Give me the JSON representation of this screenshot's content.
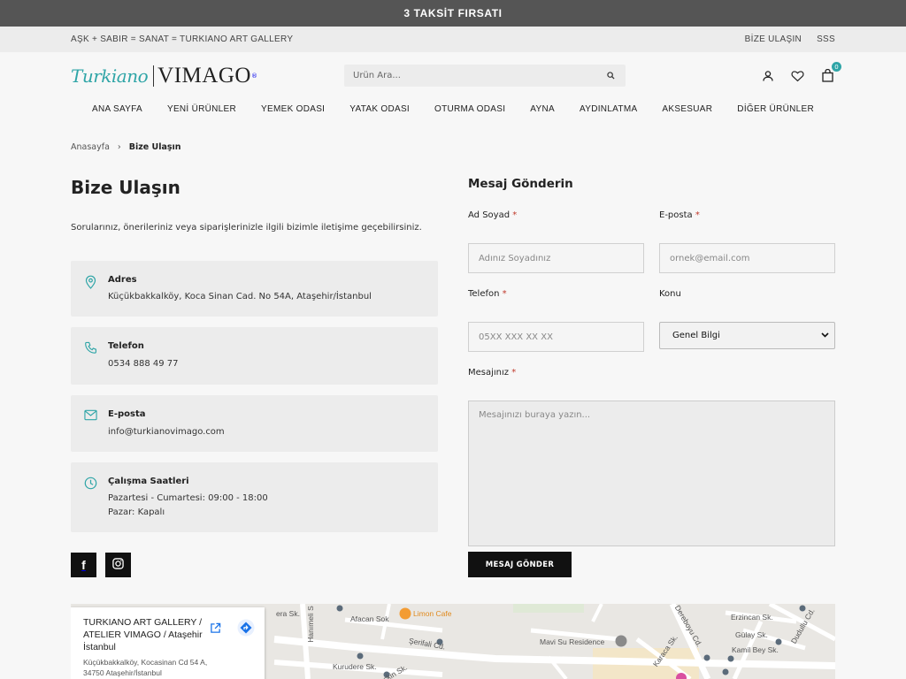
{
  "announcement": "3 TAKSİT FIRSATI",
  "topbar": {
    "tagline": "AŞK + SABIR = SANAT = TURKIANO ART GALLERY",
    "links": [
      "BİZE ULAŞIN",
      "SSS"
    ]
  },
  "logo": {
    "script": "Turkiano",
    "brand": "VIMAGO",
    "mark": "®"
  },
  "search": {
    "placeholder": "Ürün Ara...",
    "icon": "search-icon"
  },
  "header_icons": {
    "account": "user-icon",
    "wishlist": "heart-icon",
    "cart": "cart-icon",
    "cart_count": "0"
  },
  "nav": [
    "ANA SAYFA",
    "YENİ ÜRÜNLER",
    "YEMEK ODASI",
    "YATAK ODASI",
    "OTURMA ODASI",
    "AYNA",
    "AYDINLATMA",
    "AKSESUAR",
    "DİĞER ÜRÜNLER"
  ],
  "breadcrumb": {
    "home": "Anasayfa",
    "separator": "›",
    "current": "Bize Ulaşın"
  },
  "page": {
    "title": "Bize Ulaşın",
    "intro": "Sorularınız, önerileriniz veya siparişlerinizle ilgili bizimle iletişime geçebilirsiniz."
  },
  "contact_cards": [
    {
      "icon": "map-pin-icon",
      "title": "Adres",
      "lines": [
        "Küçükbakkalköy, Koca Sinan Cad. No 54A, Ataşehir/İstanbul"
      ]
    },
    {
      "icon": "phone-icon",
      "title": "Telefon",
      "lines": [
        "0534 888 49 77"
      ]
    },
    {
      "icon": "mail-icon",
      "title": "E-posta",
      "lines": [
        "info@turkianovimago.com"
      ]
    },
    {
      "icon": "clock-icon",
      "title": "Çalışma Saatleri",
      "lines": [
        "Pazartesi - Cumartesi: 09:00 - 18:00",
        "Pazar: Kapalı"
      ]
    }
  ],
  "social": {
    "facebook_icon": "facebook-icon",
    "facebook_glyph": "f",
    "instagram_icon": "instagram-icon"
  },
  "form": {
    "title": "Mesaj Gönderin",
    "required_mark": "*",
    "name": {
      "label": "Ad Soyad",
      "placeholder": "Adınız Soyadınız"
    },
    "email": {
      "label": "E-posta",
      "placeholder": "ornek@email.com"
    },
    "phone": {
      "label": "Telefon",
      "placeholder": "05XX XXX XX XX"
    },
    "subject": {
      "label": "Konu",
      "selected": "Genel Bilgi"
    },
    "message": {
      "label": "Mesajınız",
      "placeholder": "Mesajınızı buraya yazın..."
    },
    "submit": "MESAJ GÖNDER"
  },
  "map": {
    "place_name": "TURKIANO ART GALLERY / ATELIER VIMAGO / Ataşehir İstanbul",
    "address": "Küçükbakkalköy, Kocasinan Cd 54 A, 34750 Ataşehir/İstanbul",
    "labels": [
      "Afacan Sok",
      "Limon Cafe",
      "Şerifali Cd.",
      "Kurudere Sk.",
      "Mavi Su Residence",
      "Erzincan Sk.",
      "Gülay Sk.",
      "Kamil Bey Sk.",
      "Karaca Sk.",
      "Dereboyu Cd.",
      "Dudullu Cd.",
      "Hanımeli S",
      "era Sk.",
      "Keskin Sk."
    ]
  },
  "colors": {
    "accent": "#2fa5a7",
    "announce_bg": "#555555",
    "button": "#111111",
    "required": "#c0392b"
  }
}
